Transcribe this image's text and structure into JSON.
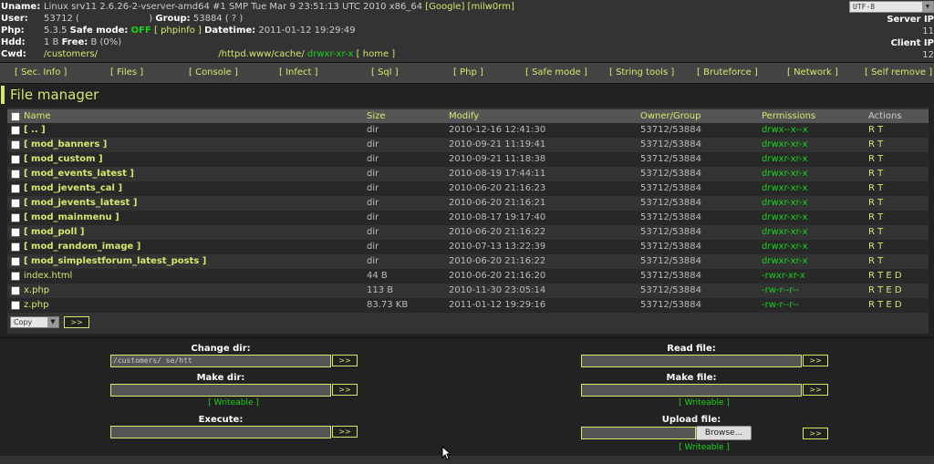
{
  "header": {
    "uname_label": "Uname:",
    "uname_value": "Linux srv11 2.6.26-2-vserver-amd64 #1 SMP Tue Mar 9 23:51:13 UTC 2010 x86_64",
    "google_link": "[Google]",
    "milw0rm_link": "[milw0rm]",
    "user_label": "User:",
    "user_value": "53712 (",
    "user_value_end": ")",
    "group_label": "Group:",
    "group_value": "53884 ( ? )",
    "php_label": "Php:",
    "php_value": "5.3.5",
    "safemode_label": "Safe mode:",
    "safemode_value": "OFF",
    "phpinfo_link": "[ phpinfo ]",
    "datetime_label": "Datetime:",
    "datetime_value": "2011-01-12 19:29:49",
    "hdd_label": "Hdd:",
    "hdd_value": "1 B",
    "free_label": "Free:",
    "free_value": "B (0%)",
    "cwd_label": "Cwd:",
    "cwd_value": "/customers/",
    "cwd_value2": "/httpd.www/cache/",
    "cwd_perm": "drwxr-xr-x",
    "home_link": "[ home ]",
    "charset": "UTF-8",
    "server_ip_label": "Server IP",
    "server_ip_value": "11",
    "client_ip_label": "Client IP",
    "client_ip_value": "12"
  },
  "menu": [
    "[ Sec. Info ]",
    "[ Files ]",
    "[ Console ]",
    "[ Infect ]",
    "[ Sql ]",
    "[ Php ]",
    "[ Safe mode ]",
    "[ String tools ]",
    "[ Bruteforce ]",
    "[ Network ]",
    "[ Self remove ]"
  ],
  "file_manager": {
    "title": "File manager",
    "columns": [
      "Name",
      "Size",
      "Modify",
      "Owner/Group",
      "Permissions",
      "Actions"
    ],
    "rows": [
      {
        "name": "[ .. ]",
        "size": "dir",
        "modify": "2010-12-16 12:41:30",
        "owner": "53712/53884",
        "perm": "drwx--x--x",
        "actions": "R T"
      },
      {
        "name": "[ mod_banners ]",
        "size": "dir",
        "modify": "2010-09-21 11:19:41",
        "owner": "53712/53884",
        "perm": "drwxr-xr-x",
        "actions": "R T"
      },
      {
        "name": "[ mod_custom ]",
        "size": "dir",
        "modify": "2010-09-21 11:18:38",
        "owner": "53712/53884",
        "perm": "drwxr-xr-x",
        "actions": "R T"
      },
      {
        "name": "[ mod_events_latest ]",
        "size": "dir",
        "modify": "2010-08-19 17:44:11",
        "owner": "53712/53884",
        "perm": "drwxr-xr-x",
        "actions": "R T"
      },
      {
        "name": "[ mod_jevents_cal ]",
        "size": "dir",
        "modify": "2010-06-20 21:16:23",
        "owner": "53712/53884",
        "perm": "drwxr-xr-x",
        "actions": "R T"
      },
      {
        "name": "[ mod_jevents_latest ]",
        "size": "dir",
        "modify": "2010-06-20 21:16:21",
        "owner": "53712/53884",
        "perm": "drwxr-xr-x",
        "actions": "R T"
      },
      {
        "name": "[ mod_mainmenu ]",
        "size": "dir",
        "modify": "2010-08-17 19:17:40",
        "owner": "53712/53884",
        "perm": "drwxr-xr-x",
        "actions": "R T"
      },
      {
        "name": "[ mod_poll ]",
        "size": "dir",
        "modify": "2010-06-20 21:16:22",
        "owner": "53712/53884",
        "perm": "drwxr-xr-x",
        "actions": "R T"
      },
      {
        "name": "[ mod_random_image ]",
        "size": "dir",
        "modify": "2010-07-13 13:22:39",
        "owner": "53712/53884",
        "perm": "drwxr-xr-x",
        "actions": "R T"
      },
      {
        "name": "[ mod_simplestforum_latest_posts ]",
        "size": "dir",
        "modify": "2010-06-20 21:16:22",
        "owner": "53712/53884",
        "perm": "drwxr-xr-x",
        "actions": "R T"
      },
      {
        "name": "index.html",
        "size": "44 B",
        "modify": "2010-06-20 21:16:20",
        "owner": "53712/53884",
        "perm": "-rwxr-xr-x",
        "actions": "R T E D"
      },
      {
        "name": "x.php",
        "size": "113 B",
        "modify": "2010-11-30 23:05:14",
        "owner": "53712/53884",
        "perm": "-rw-r--r--",
        "actions": "R T E D"
      },
      {
        "name": "z.php",
        "size": "83.73 KB",
        "modify": "2011-01-12 19:29:16",
        "owner": "53712/53884",
        "perm": "-rw-r--r--",
        "actions": "R T E D"
      }
    ],
    "copy_select": "Copy",
    "go_button": ">>"
  },
  "tools": {
    "change_dir_label": "Change dir:",
    "change_dir_value": "/customers/                              se/htt",
    "make_dir_label": "Make dir:",
    "make_dir_note": "[ Writeable ]",
    "execute_label": "Execute:",
    "read_file_label": "Read file:",
    "make_file_label": "Make file:",
    "make_file_note": "[ Writeable ]",
    "upload_file_label": "Upload file:",
    "browse_button": "Browse...",
    "upload_note": "[ Writeable ]",
    "go_button": ">>"
  },
  "colors": {
    "accent": "#d4e86b",
    "perm_green": "#19d419",
    "background": "#222222"
  }
}
